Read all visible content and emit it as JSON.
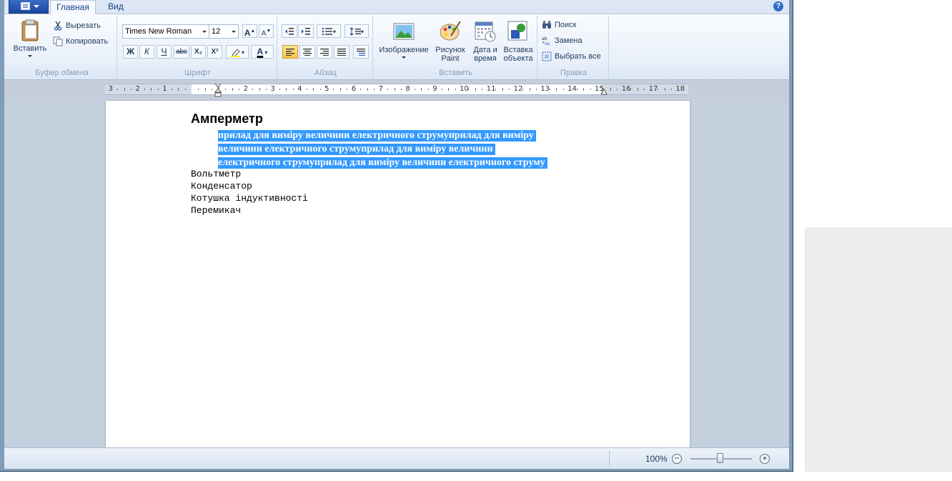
{
  "tabs": {
    "home": "Главная",
    "view": "Вид"
  },
  "clipboard": {
    "paste": "Вставить",
    "cut": "Вырезать",
    "copy": "Копировать",
    "label": "Буфер обмена"
  },
  "font": {
    "family": "Times New Roman",
    "size": "12",
    "bold": "Ж",
    "italic": "К",
    "underline": "Ч",
    "strike": "abc",
    "subscript": "X₂",
    "superscript": "X²",
    "color_letter": "A",
    "label": "Шрифт"
  },
  "paragraph": {
    "label": "Абзац"
  },
  "insert": {
    "image_label": "Изображение",
    "paint_line1": "Рисунок",
    "paint_line2": "Paint",
    "datetime_line1": "Дата и",
    "datetime_line2": "время",
    "object_line1": "Вставка",
    "object_line2": "объекта",
    "label": "Вставить"
  },
  "editing": {
    "find": "Поиск",
    "replace": "Замена",
    "select_all": "Выбрать все",
    "label": "Правка"
  },
  "ruler": {
    "labels": [
      "3",
      "2",
      "1",
      "1",
      "2",
      "3",
      "4",
      "5",
      "6",
      "7",
      "8",
      "9",
      "10",
      "11",
      "12",
      "13",
      "14",
      "15",
      "16",
      "17",
      "18"
    ]
  },
  "document": {
    "heading": "Амперметр",
    "selected_lines": [
      "прилад для виміру величини електричного струмуприлад для виміру",
      "величини електричного струмуприлад для виміру величини",
      "електричного струмуприлад для виміру величини електричного струму"
    ],
    "lines": [
      "Вольтметр",
      "Конденсатор",
      "Котушка індуктивності",
      "Перемикач"
    ]
  },
  "status": {
    "zoom": "100%",
    "zoom_out": "−",
    "zoom_in": "+"
  },
  "colors": {
    "selection": "#3399ff",
    "ribbon": "#e9f0fa",
    "workspace": "#c5d0de"
  }
}
